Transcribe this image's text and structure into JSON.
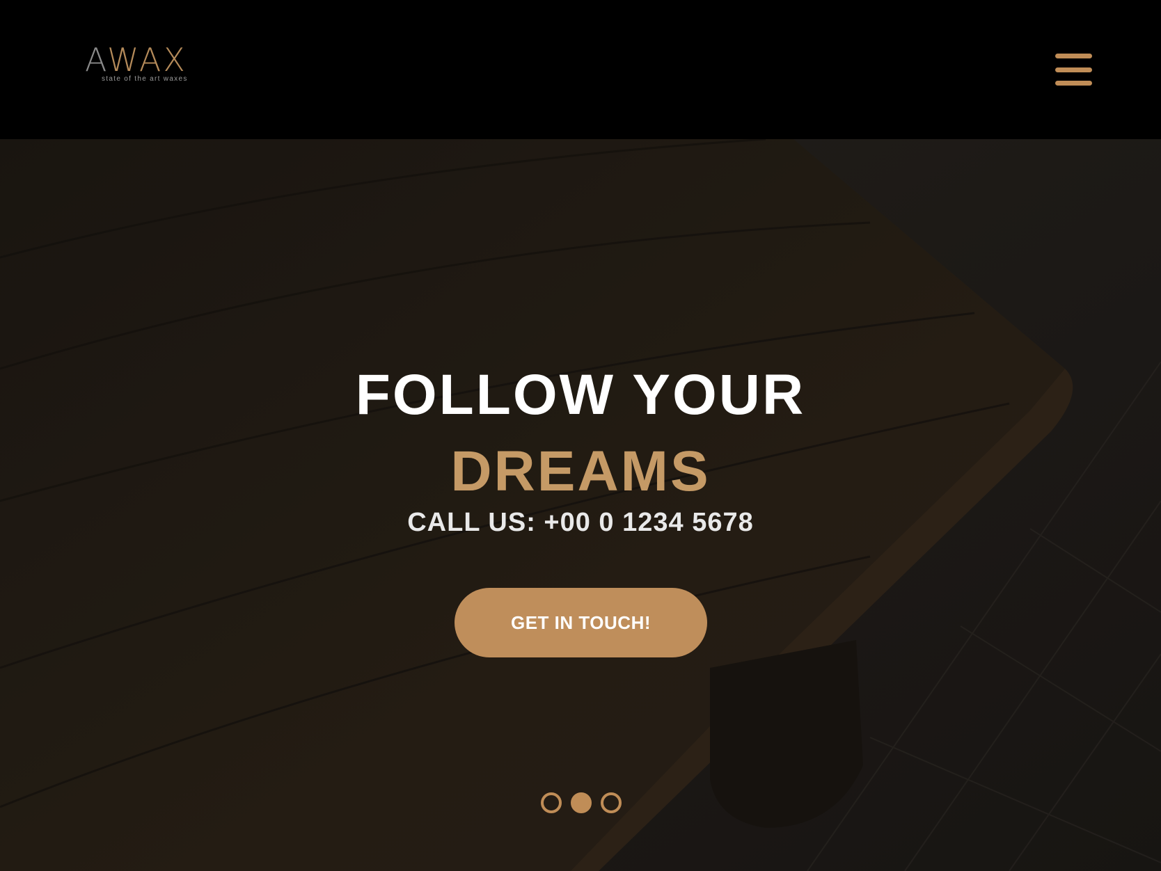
{
  "header": {
    "logo_text": "AWAX",
    "logo_tagline": "state of the art waxes",
    "menu_icon": "hamburger-menu-icon"
  },
  "hero": {
    "headline_line1": "FOLLOW YOUR",
    "headline_line2": "DREAMS",
    "call_text": "CALL US: +00 0 1234 5678",
    "cta_label": "GET IN TOUCH!",
    "slider": {
      "count": 3,
      "active_index": 1
    }
  },
  "colors": {
    "accent": "#c08d57",
    "background": "#000000",
    "headline": "#ffffff",
    "headline_accent": "#c59a66"
  }
}
